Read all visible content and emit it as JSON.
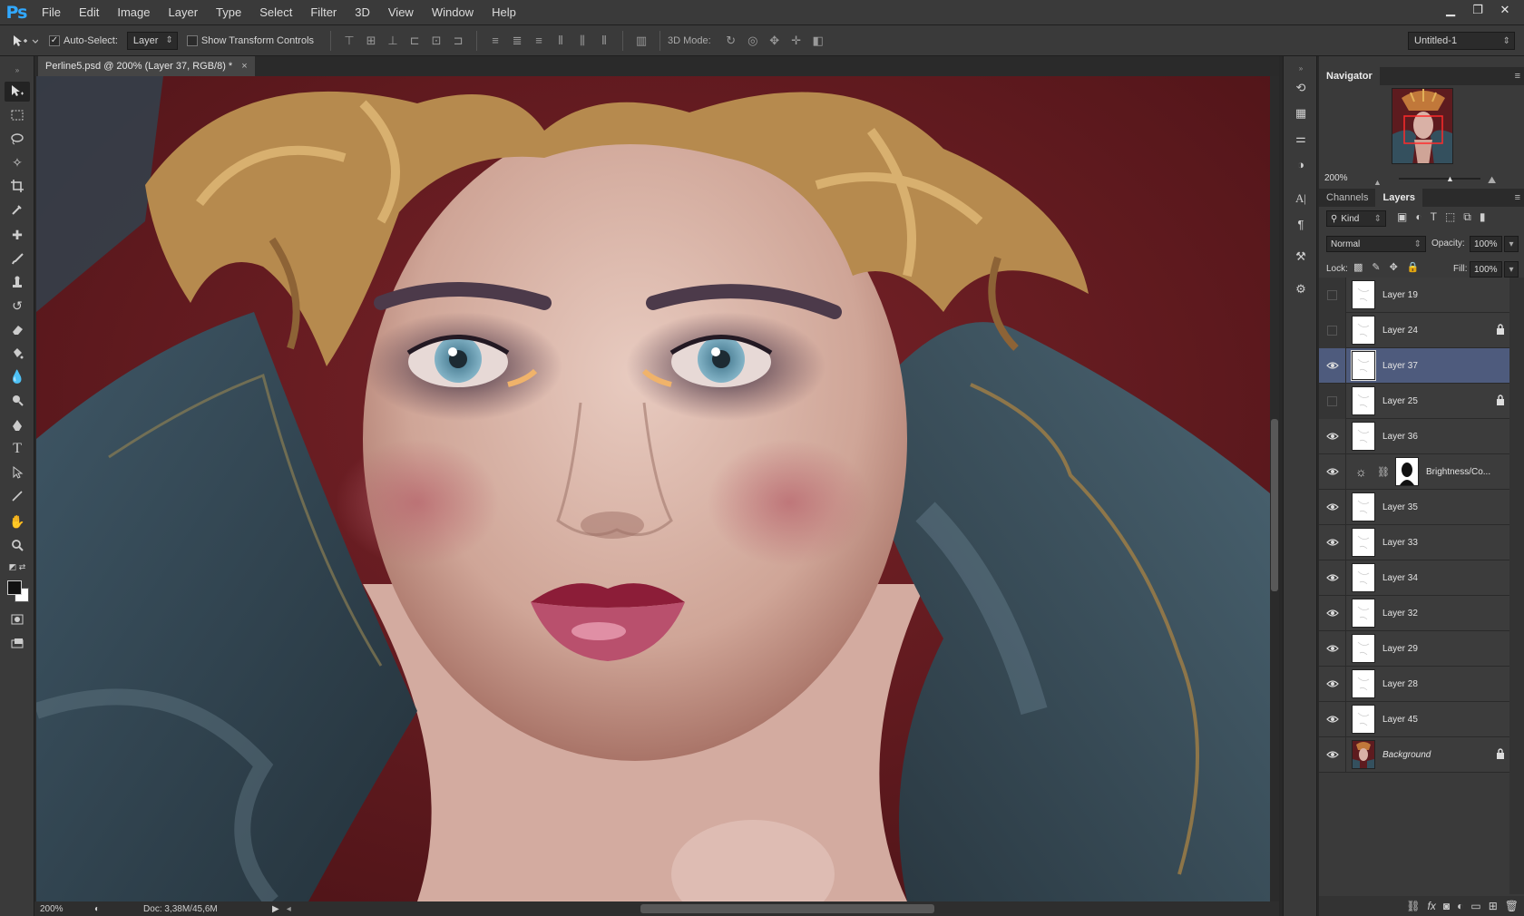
{
  "app": {
    "logo": "Ps"
  },
  "menu": [
    "File",
    "Edit",
    "Image",
    "Layer",
    "Type",
    "Select",
    "Filter",
    "3D",
    "View",
    "Window",
    "Help"
  ],
  "window_controls": {
    "minimize": "▁",
    "restore": "❐",
    "close": "✕"
  },
  "options": {
    "auto_select_label": "Auto-Select:",
    "auto_select_checked": "✓",
    "auto_select_target": "Layer",
    "show_transform_label": "Show Transform Controls",
    "mode_3d_label": "3D Mode:",
    "workspace": "Untitled-1"
  },
  "document": {
    "tab_title": "Perline5.psd @ 200% (Layer 37, RGB/8) *",
    "tab_close": "×"
  },
  "status": {
    "zoom": "200%",
    "doc_size": "Doc: 3,38M/45,6M"
  },
  "navigator": {
    "title": "Navigator",
    "zoom": "200%"
  },
  "layers_panel": {
    "tabs": [
      "Channels",
      "Layers"
    ],
    "active_tab": "Layers",
    "kind_label": "Kind",
    "blend_mode": "Normal",
    "opacity_label": "Opacity:",
    "opacity": "100%",
    "lock_label": "Lock:",
    "fill_label": "Fill:",
    "fill": "100%",
    "layers": [
      {
        "name": "Layer 19",
        "visible": false,
        "locked": false,
        "selected": false
      },
      {
        "name": "Layer 24",
        "visible": false,
        "locked": true,
        "selected": false
      },
      {
        "name": "Layer 37",
        "visible": true,
        "locked": false,
        "selected": true
      },
      {
        "name": "Layer 25",
        "visible": false,
        "locked": true,
        "selected": false
      },
      {
        "name": "Layer 36",
        "visible": true,
        "locked": false,
        "selected": false
      },
      {
        "name": "Brightness/Co...",
        "visible": true,
        "locked": false,
        "selected": false,
        "adjustment": true
      },
      {
        "name": "Layer 35",
        "visible": true,
        "locked": false,
        "selected": false
      },
      {
        "name": "Layer 33",
        "visible": true,
        "locked": false,
        "selected": false
      },
      {
        "name": "Layer 34",
        "visible": true,
        "locked": false,
        "selected": false
      },
      {
        "name": "Layer 32",
        "visible": true,
        "locked": false,
        "selected": false
      },
      {
        "name": "Layer 29",
        "visible": true,
        "locked": false,
        "selected": false
      },
      {
        "name": "Layer 28",
        "visible": true,
        "locked": false,
        "selected": false
      },
      {
        "name": "Layer 45",
        "visible": true,
        "locked": false,
        "selected": false
      },
      {
        "name": "Background",
        "visible": true,
        "locked": true,
        "selected": false,
        "italic": true
      }
    ]
  },
  "colors": {
    "ui_bg": "#3a3a3a",
    "panel_dark": "#2b2b2b",
    "selection": "#4e5b7d",
    "ps_blue": "#31a8ff"
  }
}
